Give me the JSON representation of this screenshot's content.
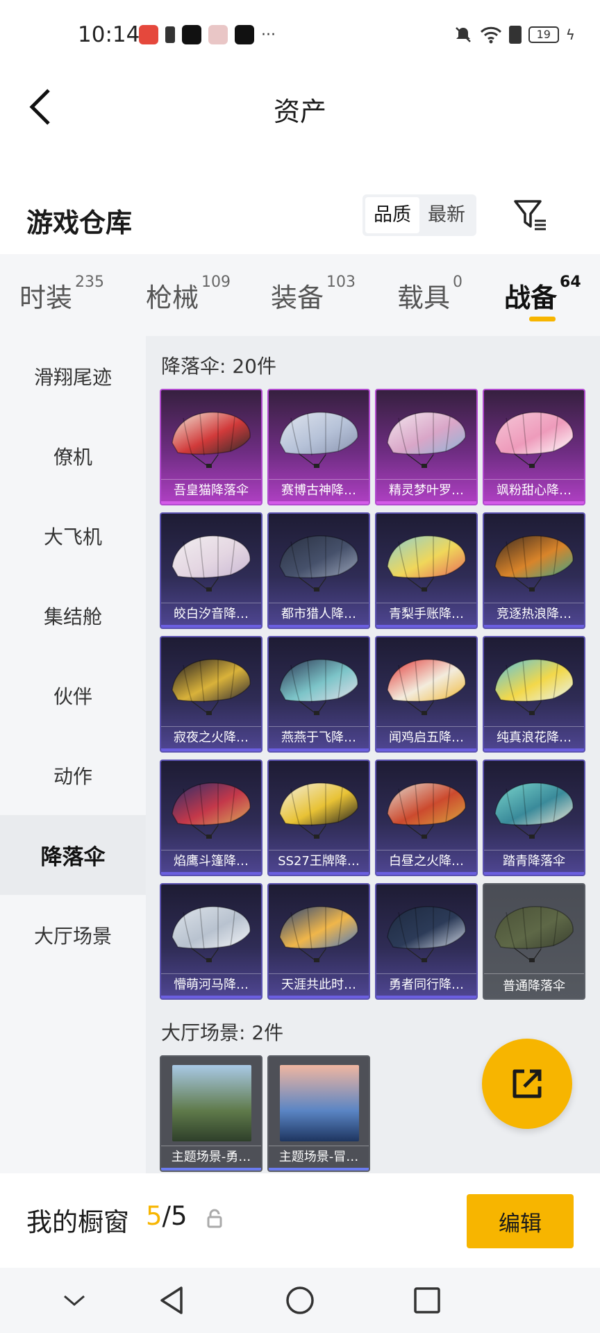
{
  "status_bar": {
    "time": "10:14",
    "battery": "19",
    "more": "···"
  },
  "header": {
    "title": "资产",
    "back_icon": "chevron-left-icon"
  },
  "warehouse": {
    "title": "游戏仓库",
    "sort_options": [
      "品质",
      "最新"
    ],
    "filter_icon": "filter-icon"
  },
  "category_tabs": [
    {
      "label": "时装",
      "count": "235"
    },
    {
      "label": "枪械",
      "count": "109"
    },
    {
      "label": "装备",
      "count": "103"
    },
    {
      "label": "载具",
      "count": "0"
    },
    {
      "label": "战备",
      "count": "64",
      "active": true
    }
  ],
  "sidebar": {
    "items": [
      "滑翔尾迹",
      "僚机",
      "大飞机",
      "集结舱",
      "伙伴",
      "动作",
      "降落伞",
      "大厅场景"
    ],
    "active_index": 6
  },
  "sections": {
    "parachute_title": "降落伞: 20件",
    "scene_title": "大厅场景: 2件"
  },
  "parachutes": [
    {
      "label": "吾皇猫降落伞",
      "rarity": "pink",
      "colors": [
        "#f2e8da",
        "#d13a3a",
        "#2b2b2b"
      ]
    },
    {
      "label": "赛博古神降…",
      "rarity": "pink",
      "colors": [
        "#dfe4ee",
        "#b6c2d8",
        "#8a94b0"
      ]
    },
    {
      "label": "精灵梦叶罗…",
      "rarity": "pink",
      "colors": [
        "#f3e6ee",
        "#d9a6c8",
        "#8fb5d8"
      ]
    },
    {
      "label": "飒粉甜心降…",
      "rarity": "pink",
      "colors": [
        "#f5c7d8",
        "#ee9bbb",
        "#ffffff"
      ]
    },
    {
      "label": "皎白汐音降…",
      "rarity": "purple",
      "colors": [
        "#f2eef0",
        "#e4d6e2",
        "#c9b8d4"
      ]
    },
    {
      "label": "都市猎人降…",
      "rarity": "purple",
      "colors": [
        "#2a3142",
        "#46516b",
        "#9aa4b8"
      ]
    },
    {
      "label": "青梨手账降…",
      "rarity": "purple",
      "colors": [
        "#8ccfd0",
        "#f0d75a",
        "#e56a5a"
      ]
    },
    {
      "label": "竞逐热浪降…",
      "rarity": "purple",
      "colors": [
        "#3a2a20",
        "#d9842a",
        "#3fa58a"
      ]
    },
    {
      "label": "寂夜之火降…",
      "rarity": "purple",
      "colors": [
        "#1d1a22",
        "#d9b23a",
        "#2b2833"
      ]
    },
    {
      "label": "燕燕于飞降…",
      "rarity": "purple",
      "colors": [
        "#2a3350",
        "#7cc4c8",
        "#e4e0ea"
      ]
    },
    {
      "label": "闻鸡启五降…",
      "rarity": "purple",
      "colors": [
        "#e23b3b",
        "#f3ecdd",
        "#f0b838"
      ]
    },
    {
      "label": "纯真浪花降…",
      "rarity": "purple",
      "colors": [
        "#58c2e0",
        "#f3d84a",
        "#e6f3f6"
      ]
    },
    {
      "label": "焰鹰斗篷降…",
      "rarity": "purple",
      "colors": [
        "#2a2e6a",
        "#c4384a",
        "#d9a85a"
      ]
    },
    {
      "label": "SS27王牌降…",
      "rarity": "purple",
      "colors": [
        "#f3efe0",
        "#e8c235",
        "#1f1f1f"
      ]
    },
    {
      "label": "白昼之火降…",
      "rarity": "purple",
      "colors": [
        "#e2dad0",
        "#cc4a2e",
        "#d9a640"
      ]
    },
    {
      "label": "踏青降落伞",
      "rarity": "purple",
      "colors": [
        "#7bd6cc",
        "#3a8a9a",
        "#efe7d6"
      ]
    },
    {
      "label": "懵萌河马降…",
      "rarity": "purple",
      "colors": [
        "#dde3ea",
        "#b8c2cf",
        "#f3f5f8"
      ]
    },
    {
      "label": "天涯共此时…",
      "rarity": "purple",
      "colors": [
        "#23417a",
        "#f0b64a",
        "#4a78c2"
      ]
    },
    {
      "label": "勇者同行降…",
      "rarity": "purple",
      "colors": [
        "#1e2a40",
        "#2c3b58",
        "#cfd6e2"
      ]
    },
    {
      "label": "普通降落伞",
      "rarity": "gray",
      "colors": [
        "#4b5238",
        "#5e6847",
        "#3a4030"
      ]
    }
  ],
  "scenes": [
    {
      "label": "主题场景-勇…",
      "colors": [
        "#a9c9e6",
        "#5f7a4a",
        "#2e3f2a"
      ]
    },
    {
      "label": "主题场景-冒…",
      "colors": [
        "#f0b6a0",
        "#5a85c4",
        "#1e3560"
      ]
    }
  ],
  "showcase": {
    "label": "我的橱窗",
    "current": "5",
    "total": "/5",
    "edit_label": "编辑"
  },
  "accent_color": "#f7b500"
}
